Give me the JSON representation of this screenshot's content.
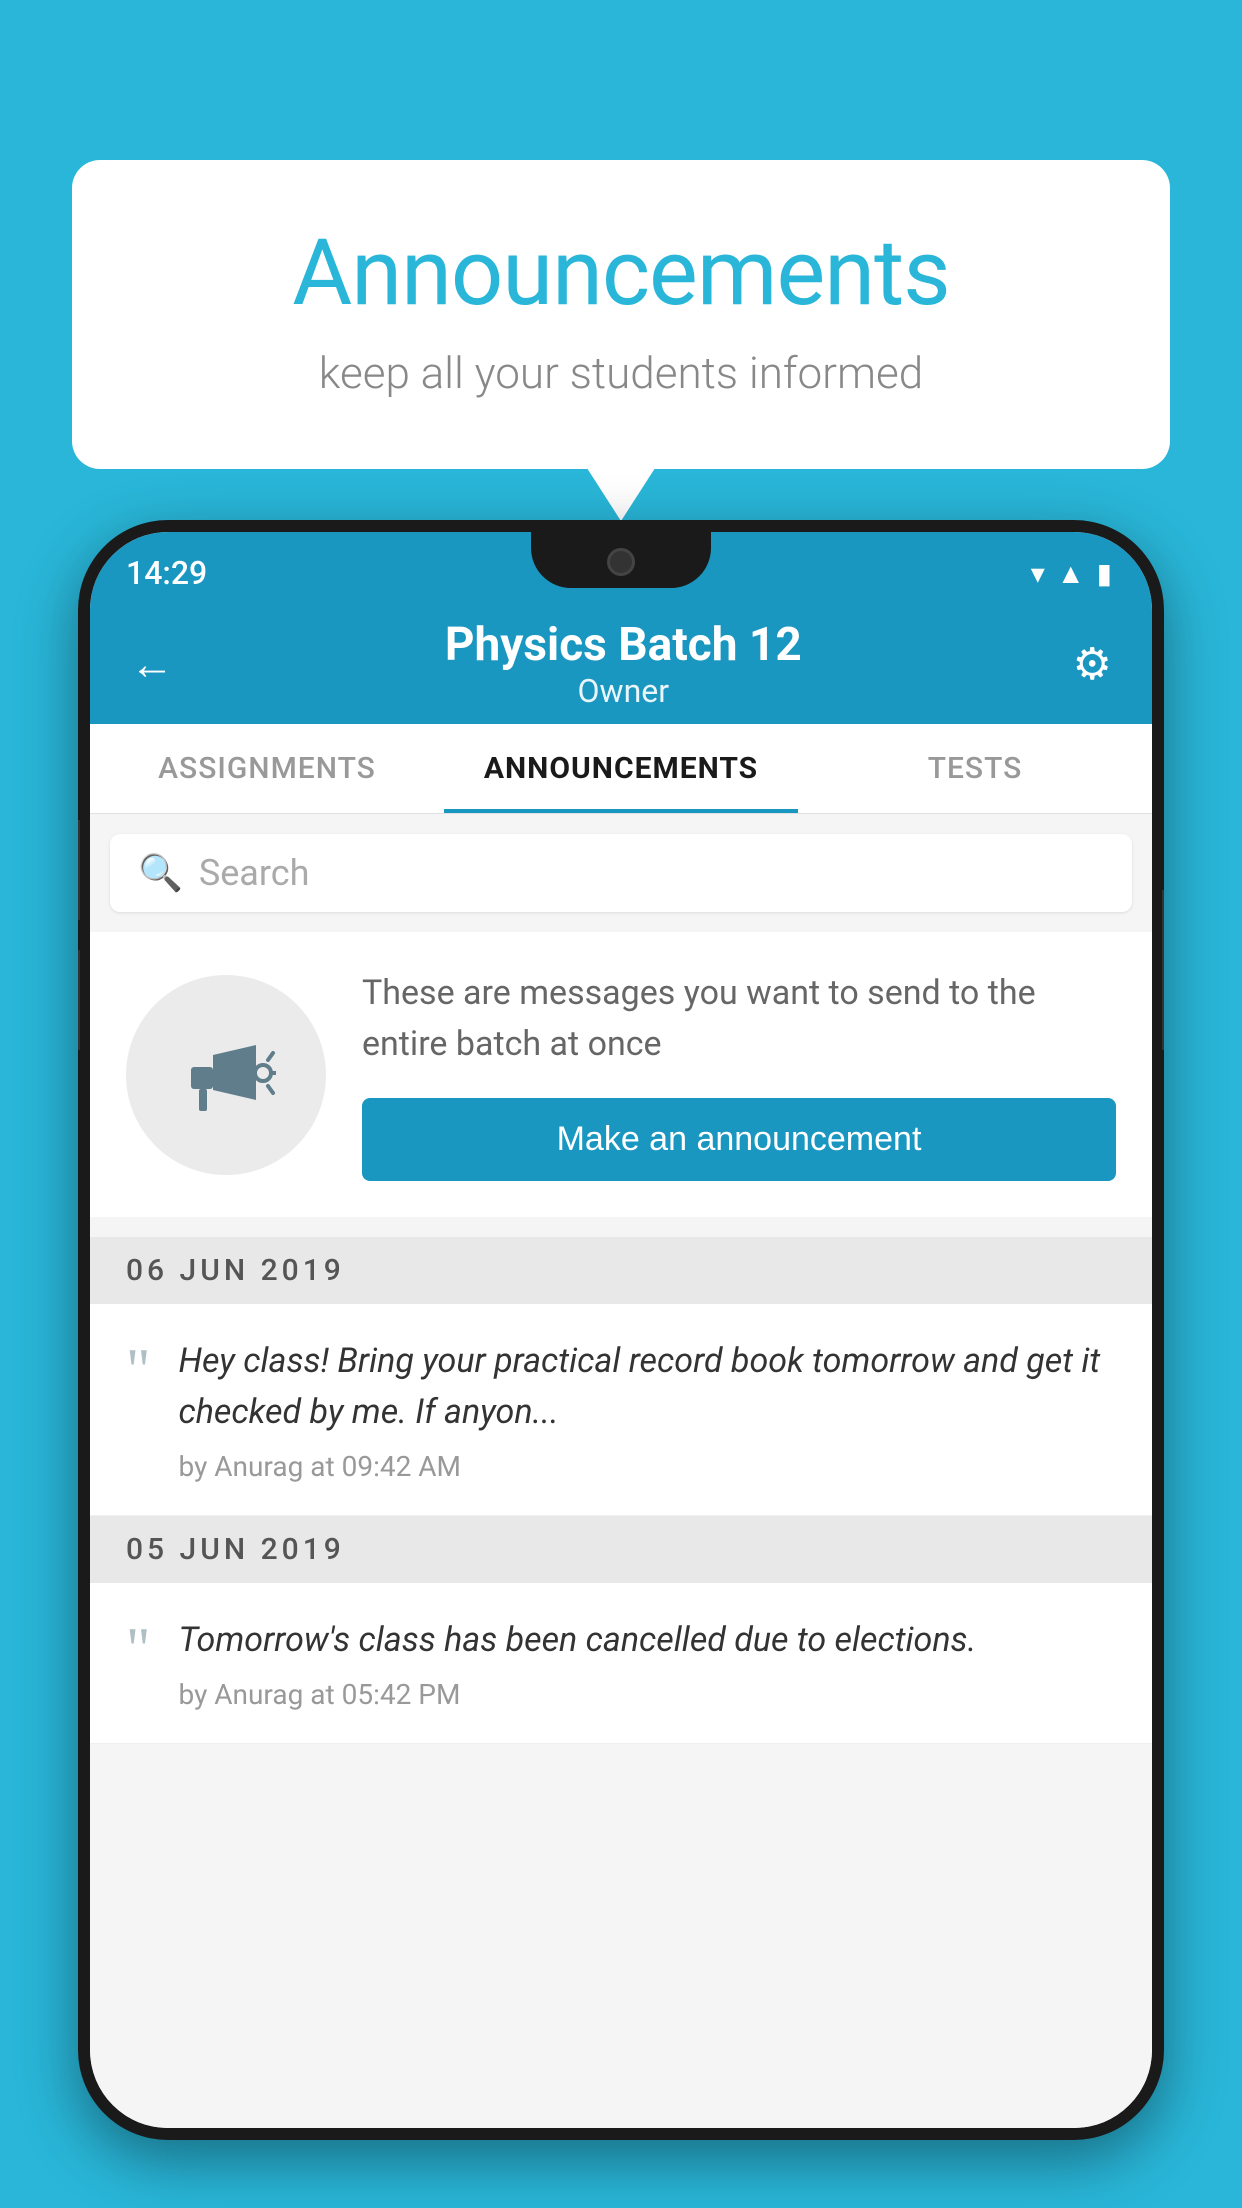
{
  "background_color": "#29b6d8",
  "speech_bubble": {
    "title": "Announcements",
    "subtitle": "keep all your students informed"
  },
  "phone": {
    "status_bar": {
      "time": "14:29",
      "icons": [
        "wifi",
        "signal",
        "battery"
      ]
    },
    "header": {
      "title": "Physics Batch 12",
      "subtitle": "Owner",
      "back_label": "←",
      "gear_label": "⚙"
    },
    "tabs": [
      {
        "label": "ASSIGNMENTS",
        "active": false
      },
      {
        "label": "ANNOUNCEMENTS",
        "active": true
      },
      {
        "label": "TESTS",
        "active": false
      }
    ],
    "search": {
      "placeholder": "Search"
    },
    "intro": {
      "text": "These are messages you want to send to the entire batch at once",
      "button_label": "Make an announcement"
    },
    "announcements": [
      {
        "date": "06  JUN  2019",
        "text": "Hey class! Bring your practical record book tomorrow and get it checked by me. If anyon...",
        "meta": "by Anurag at 09:42 AM"
      },
      {
        "date": "05  JUN  2019",
        "text": "Tomorrow's class has been cancelled due to elections.",
        "meta": "by Anurag at 05:42 PM"
      }
    ]
  }
}
